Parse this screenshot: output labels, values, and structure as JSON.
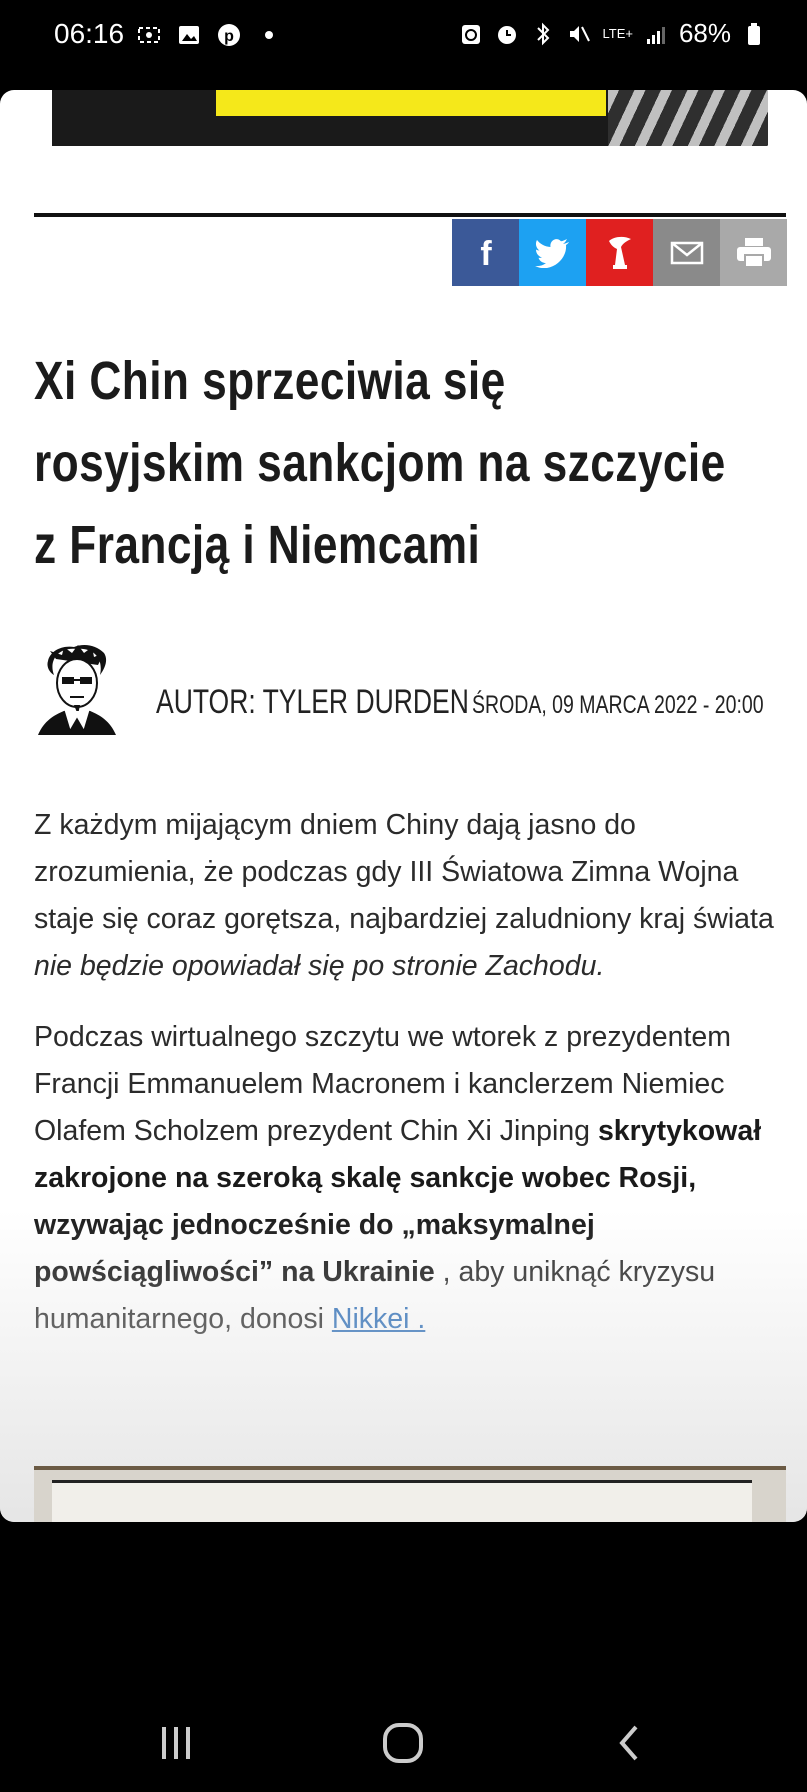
{
  "status_bar": {
    "time": "06:16",
    "battery": "68%",
    "network": "LTE+"
  },
  "share": {
    "buttons": [
      {
        "name": "facebook",
        "color": "#3b5998"
      },
      {
        "name": "twitter",
        "color": "#1da1f2"
      },
      {
        "name": "wykop",
        "color": "#e02020"
      },
      {
        "name": "email",
        "color": "#8a8a8a"
      },
      {
        "name": "print",
        "color": "#a9a9a9"
      }
    ]
  },
  "article": {
    "title_lines": [
      "Xi Chin sprzeciwia się",
      "rosyjskim sankcjom na szczycie",
      "z Francją i Niemcami"
    ],
    "author": "AUTOR: TYLER DURDEN",
    "date": "ŚRODA, 09 MARCA 2022 - 20:00",
    "p1_text": "Z każdym mijającym dniem Chiny dają jasno do zrozumienia, że podczas gdy III Światowa Zimna Wojna staje się coraz gorętsza, najbardziej zaludniony kraj świata ",
    "p1_italic": "nie będzie opowiadał się po stronie Zachodu.",
    "p2_text": "Podczas wirtualnego szczytu we wtorek z prezydentem Francji Emmanuelem Macronem i kanclerzem Niemiec Olafem Scholzem prezydent Chin Xi Jinping ",
    "p2_bold": "skrytykował zakrojone na szeroką skalę sankcje wobec Rosji, wzywając jednocześnie do „maksymalnej powściągliwości” na Ukrainie",
    "p2_tail": " , aby uniknąć kryzysu humanitarnego, donosi ",
    "p2_link": "Nikkei ."
  },
  "colors": {
    "ad_yellow": "#f5e81a",
    "link": "#2a6db8",
    "title": "#1b1b1b"
  }
}
